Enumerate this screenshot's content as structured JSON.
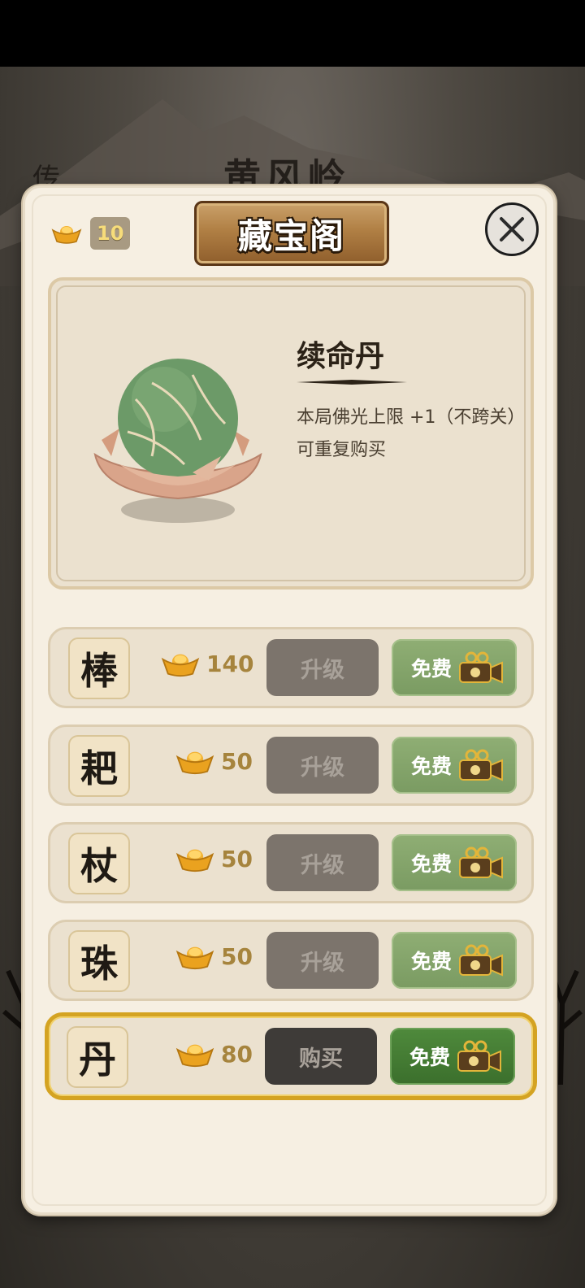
{
  "background": {
    "title": "黄风岭",
    "left_text": "传"
  },
  "dialog": {
    "title": "藏宝阁",
    "currency": {
      "icon": "gold-ingot-icon",
      "count": "10"
    },
    "close_icon": "close-icon"
  },
  "featured": {
    "name": "续命丹",
    "description": "本局佛光上限 +1（不跨关）",
    "note": "可重复购买",
    "image": "green-pill-on-leaf-bowl"
  },
  "items": [
    {
      "glyph": "棒",
      "price": "140",
      "action": "升级",
      "free": "免费",
      "selected": false
    },
    {
      "glyph": "耙",
      "price": "50",
      "action": "升级",
      "free": "免费",
      "selected": false
    },
    {
      "glyph": "杖",
      "price": "50",
      "action": "升级",
      "free": "免费",
      "selected": false
    },
    {
      "glyph": "珠",
      "price": "50",
      "action": "升级",
      "free": "免费",
      "selected": false
    },
    {
      "glyph": "丹",
      "price": "80",
      "action": "购买",
      "free": "免费",
      "selected": true
    }
  ],
  "colors": {
    "panel": "#f6efe2",
    "price_gold": "#a6843d",
    "free_green": "#7a9b62",
    "selected_border": "#d4a322"
  }
}
